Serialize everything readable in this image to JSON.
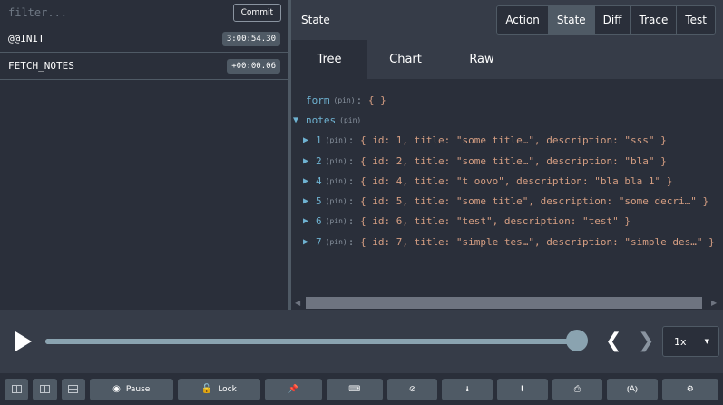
{
  "filter": {
    "placeholder": "filter..."
  },
  "commit_label": "Commit",
  "actions": [
    {
      "name": "@@INIT",
      "time": "3:00:54.30"
    },
    {
      "name": "FETCH_NOTES",
      "time": "+00:00.06"
    }
  ],
  "right": {
    "title": "State",
    "mode_tabs": [
      "Action",
      "State",
      "Diff",
      "Trace",
      "Test"
    ],
    "active_mode": "State",
    "view_tabs": [
      "Tree",
      "Chart",
      "Raw"
    ],
    "active_view": "Tree"
  },
  "tree": {
    "pin": "(pin)",
    "form": {
      "key": "form",
      "value": "{ }"
    },
    "notes": {
      "key": "notes"
    },
    "items": [
      {
        "key": "1",
        "value": "{ id: 1, title: \"some title…\", description: \"sss\" }"
      },
      {
        "key": "2",
        "value": "{ id: 2, title: \"some title…\", description: \"bla\" }"
      },
      {
        "key": "4",
        "value": "{ id: 4, title: \"t oovo\", description: \"bla bla 1\" }"
      },
      {
        "key": "5",
        "value": "{ id: 5, title: \"some title\", description: \"some decri…\" }"
      },
      {
        "key": "6",
        "value": "{ id: 6, title: \"test\", description: \"test\" }"
      },
      {
        "key": "7",
        "value": "{ id: 7, title: \"simple tes…\", description: \"simple des…\" }"
      }
    ]
  },
  "slider": {
    "progress": 1.0,
    "speed": "1x"
  },
  "toolbar": {
    "pause_label": "Pause",
    "lock_label": "Lock"
  },
  "icons": {
    "play": "play-icon",
    "prev": "chevron-left-icon",
    "next": "chevron-right-icon",
    "pause": "record-icon",
    "lock": "lock-icon",
    "pin": "pin-icon",
    "keyboard": "keyboard-icon",
    "sync": "sync-disabled-icon",
    "export": "upload-icon",
    "import": "download-icon",
    "print": "print-icon",
    "remote": "remote-icon",
    "settings": "gear-icon"
  },
  "colors": {
    "key": "#6fb3d2",
    "value": "#d59e82",
    "background": "#2a2f3a",
    "panel": "#363c48"
  }
}
